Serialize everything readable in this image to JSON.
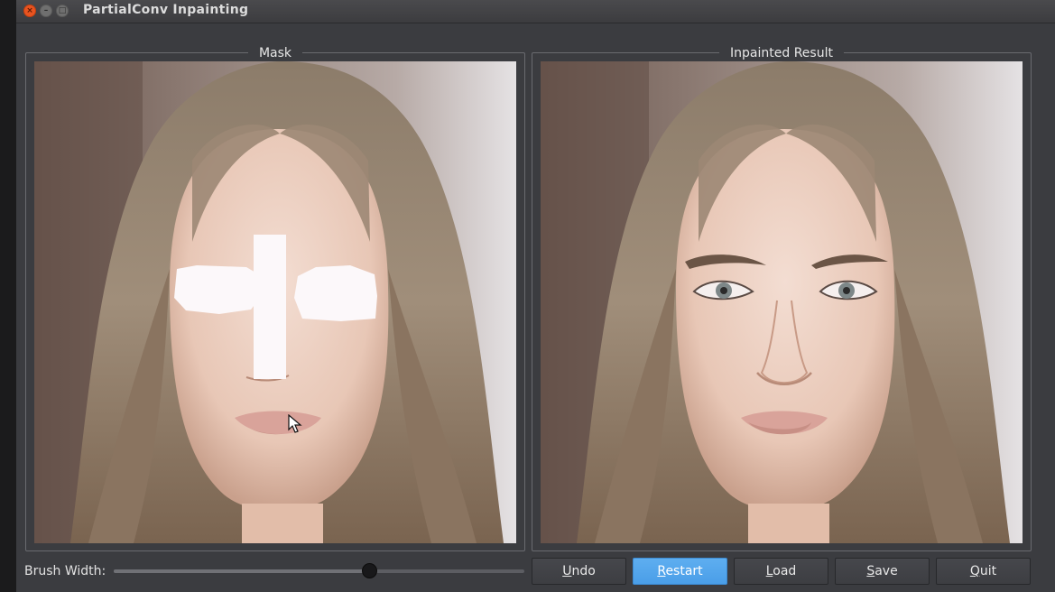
{
  "window": {
    "title": "PartialConv Inpainting"
  },
  "panels": {
    "mask": {
      "title": "Mask"
    },
    "result": {
      "title": "Inpainted Result"
    }
  },
  "controls": {
    "brush_label": "Brush Width:",
    "brush_width_fraction": 0.625,
    "buttons": {
      "undo": {
        "first": "U",
        "rest": "ndo"
      },
      "restart": {
        "first": "R",
        "rest": "estart"
      },
      "load": {
        "first": "L",
        "rest": "oad"
      },
      "save": {
        "first": "S",
        "rest": "ave"
      },
      "quit": {
        "first": "Q",
        "rest": "uit"
      }
    }
  },
  "colors": {
    "primary_button": "#4a9ee8",
    "window_bg": "#3b3c40",
    "close_button": "#e95420"
  },
  "icons": [
    "close-icon",
    "minimize-icon",
    "maximize-icon",
    "mouse-cursor-icon"
  ]
}
